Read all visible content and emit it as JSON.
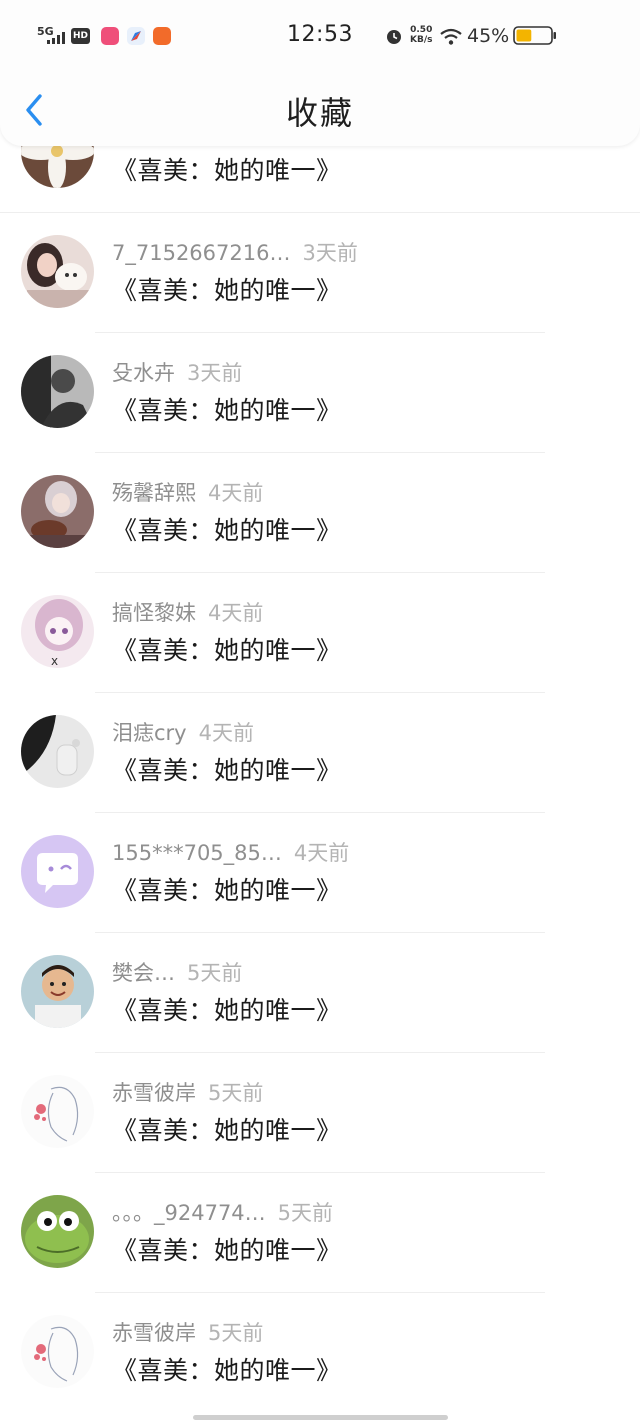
{
  "status_bar": {
    "network": "5G",
    "hd": "HD",
    "time": "12:53",
    "speed_value": "0.50",
    "speed_unit": "KB/s",
    "battery": "45%",
    "battery_level": 0.45
  },
  "header": {
    "title": "收藏"
  },
  "favorites": [
    {
      "user": "",
      "time": "",
      "title": "《喜美：她的唯一》",
      "avatar": "flower"
    },
    {
      "user": "7_7152667216…",
      "time": "3天前",
      "title": "《喜美：她的唯一》",
      "avatar": "girl-pet"
    },
    {
      "user": "殳水卉",
      "time": "3天前",
      "title": "《喜美：她的唯一》",
      "avatar": "bw-photo"
    },
    {
      "user": "殇馨辞熙",
      "time": "4天前",
      "title": "《喜美：她的唯一》",
      "avatar": "anime-guitar"
    },
    {
      "user": "搞怪黎妹",
      "time": "4天前",
      "title": "《喜美：她的唯一》",
      "avatar": "anime-girl"
    },
    {
      "user": "泪痣cry",
      "time": "4天前",
      "title": "《喜美：她的唯一》",
      "avatar": "dark-hand"
    },
    {
      "user": "155***705_85…",
      "time": "4天前",
      "title": "《喜美：她的唯一》",
      "avatar": "default-chat"
    },
    {
      "user": "樊会…",
      "time": "5天前",
      "title": "《喜美：她的唯一》",
      "avatar": "child"
    },
    {
      "user": "赤雪彼岸",
      "time": "5天前",
      "title": "《喜美：她的唯一》",
      "avatar": "sketch-girl"
    },
    {
      "user": "。。。_924774…",
      "time": "5天前",
      "title": "《喜美：她的唯一》",
      "avatar": "frog"
    },
    {
      "user": "赤雪彼岸",
      "time": "5天前",
      "title": "《喜美：她的唯一》",
      "avatar": "sketch-girl"
    }
  ]
}
